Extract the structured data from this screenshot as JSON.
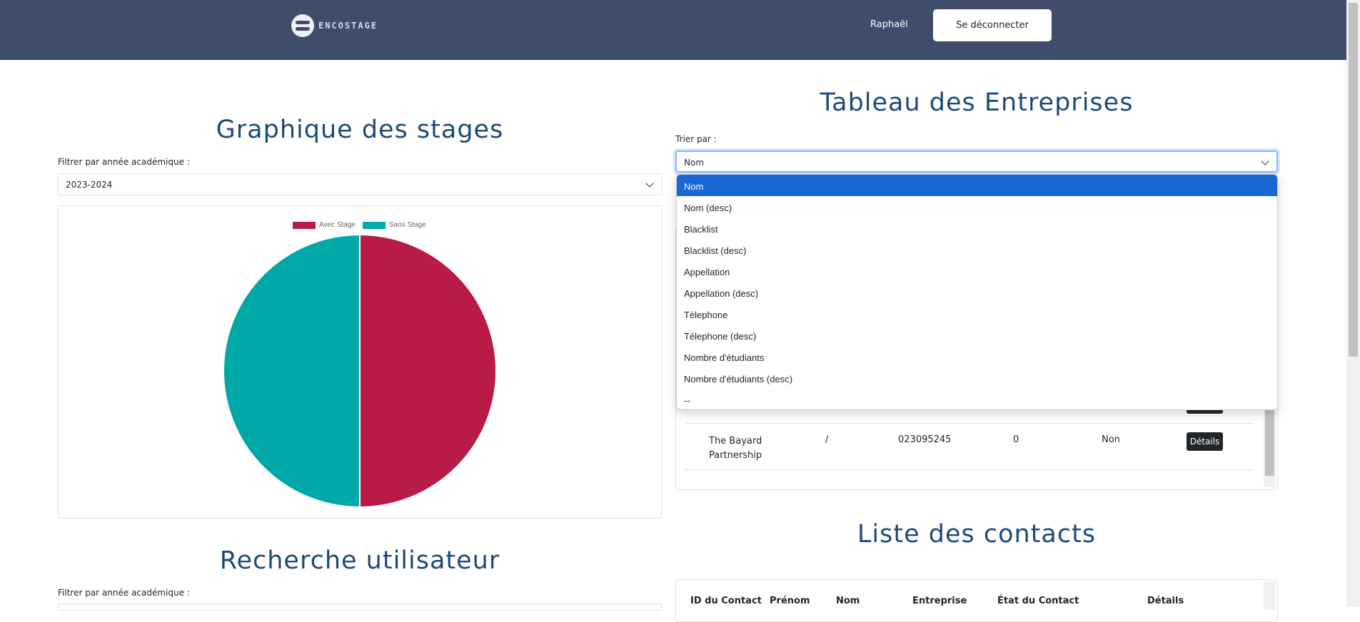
{
  "header": {
    "logo_text": "ENCOSTAGE",
    "user_name": "Raphaël",
    "logout_label": "Se déconnecter"
  },
  "stats": {
    "title": "Graphique des stages",
    "filter_label": "Filtrer par année académique :",
    "filter_value": "2023-2024"
  },
  "chart_data": {
    "type": "pie",
    "categories": [
      "Avec Stage",
      "Sans Stage"
    ],
    "values": [
      50,
      50
    ],
    "colors": [
      "#b81b46",
      "#00a8a8"
    ],
    "legend_placement": "top"
  },
  "companies": {
    "title": "Tableau des Entreprises",
    "sort_label": "Trier par :",
    "sort_value": "Nom",
    "sort_options": [
      "Nom",
      "Nom (desc)",
      "Blacklist",
      "Blacklist (desc)",
      "Appellation",
      "Appellation (desc)",
      "Télephone",
      "Télephone (desc)",
      "Nombre d'étudiants",
      "Nombre d'étudiants (desc)",
      "--"
    ],
    "rows": [
      {
        "name_line1": "The Bayard",
        "name_line2": "Partnership",
        "appellation": "/",
        "phone": "023095245",
        "students": "0",
        "blacklisted": "Non",
        "details_label": "Détails"
      }
    ]
  },
  "contacts": {
    "title": "Liste des contacts",
    "headers": [
      "ID du Contact",
      "Prénom",
      "Nom",
      "Entreprise",
      "État du Contact",
      "Détails"
    ]
  },
  "user_search": {
    "title": "Recherche utilisateur",
    "filter_label": "Filtrer par année académique :"
  }
}
